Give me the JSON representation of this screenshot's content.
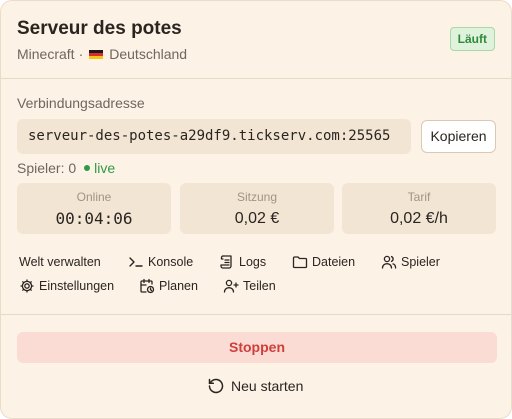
{
  "server": {
    "name": "Serveur des potes",
    "game": "Minecraft",
    "separator": "·",
    "region": "Deutschland",
    "status": "Läuft"
  },
  "connection": {
    "label": "Verbindungsadresse",
    "address": "serveur-des-potes-a29df9.tickserv.com:25565",
    "copy_label": "Kopieren"
  },
  "players": {
    "text": "Spieler: 0",
    "live_label": "live"
  },
  "stats": [
    {
      "label": "Online",
      "value": "00:04:06"
    },
    {
      "label": "Sitzung",
      "value": "0,02 €"
    },
    {
      "label": "Tarif",
      "value": "0,02 €/h"
    }
  ],
  "actions": {
    "world": "Welt verwalten",
    "console": "Konsole",
    "logs": "Logs",
    "files": "Dateien",
    "players": "Spieler",
    "settings": "Einstellungen",
    "schedule": "Planen",
    "share": "Teilen"
  },
  "controls": {
    "stop_label": "Stoppen",
    "restart_label": "Neu starten"
  },
  "colors": {
    "card_bg": "#fdf2e6",
    "status_green": "#2f9a45",
    "danger": "#cf3e3a"
  }
}
